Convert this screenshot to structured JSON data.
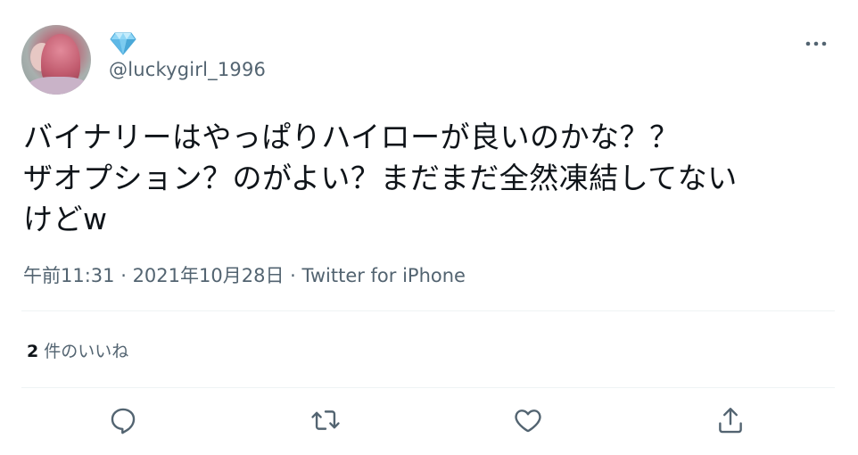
{
  "user": {
    "handle": "@luckygirl_1996",
    "badge_icon": "diamond-icon",
    "avatar_icon": "profile-photo"
  },
  "tweet": {
    "lines": [
      "バイナリーはやっぱりハイローが良いのかな？？",
      "ザオプション？のがよい？まだまだ全然凍結してない",
      "けどw"
    ]
  },
  "meta": {
    "time": "午前11:31",
    "separator": " · ",
    "date": "2021年10月28日",
    "source": "Twitter for iPhone"
  },
  "likes": {
    "count": "2",
    "label": "件のいいね"
  },
  "actions": [
    {
      "name": "reply",
      "icon": "reply-icon"
    },
    {
      "name": "retweet",
      "icon": "retweet-icon"
    },
    {
      "name": "like",
      "icon": "heart-icon"
    },
    {
      "name": "share",
      "icon": "share-icon"
    }
  ],
  "colors": {
    "text": "#0f1419",
    "secondary": "#536471",
    "divider": "#eff3f4",
    "badge": "#6ec6f0"
  }
}
